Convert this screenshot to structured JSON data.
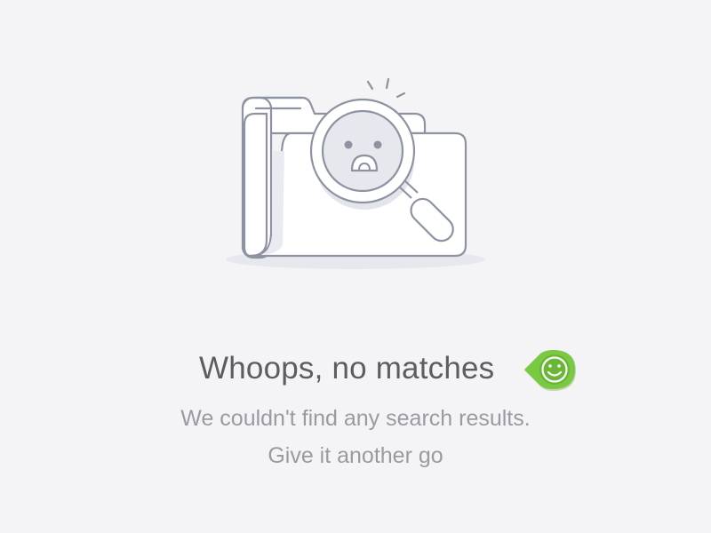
{
  "empty_state": {
    "illustration_icon": "folder-magnifier-sad-face-icon",
    "title": "Whoops, no matches",
    "badge_icon": "smiley-face-icon",
    "message_line1": "We couldn't find any search results.",
    "message_line2": "Give it another go"
  },
  "colors": {
    "background": "#f4f4f7",
    "title": "#5c5c63",
    "message": "#9a9aa1",
    "illustration_stroke": "#8d93a1",
    "illustration_shadow": "#dfe1e8",
    "badge_green": "#7ac943"
  }
}
